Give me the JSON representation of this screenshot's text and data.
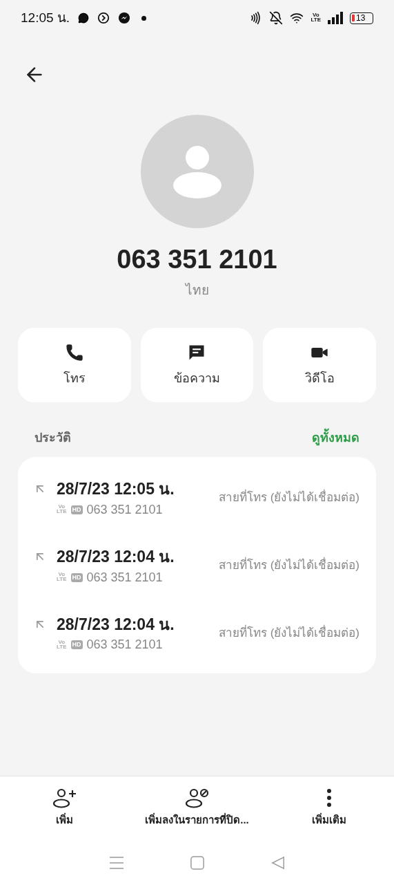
{
  "status_bar": {
    "time": "12:05 น.",
    "volte": [
      "Vo",
      "LTE"
    ],
    "battery": "13"
  },
  "contact": {
    "number": "063 351 2101",
    "location": "ไทย"
  },
  "actions": [
    {
      "kind": "call",
      "label": "โทร"
    },
    {
      "kind": "message",
      "label": "ข้อความ"
    },
    {
      "kind": "video",
      "label": "วิดีโอ"
    }
  ],
  "history": {
    "title": "ประวัติ",
    "see_all": "ดูทั้งหมด",
    "calls": [
      {
        "datetime": "28/7/23 12:05 น.",
        "volte": [
          "Vo",
          "LTE"
        ],
        "hd": "HD",
        "number": "063 351 2101",
        "status": "สายที่โทร (ยังไม่ได้เชื่อมต่อ)"
      },
      {
        "datetime": "28/7/23 12:04 น.",
        "volte": [
          "Vo",
          "LTE"
        ],
        "hd": "HD",
        "number": "063 351 2101",
        "status": "สายที่โทร (ยังไม่ได้เชื่อมต่อ)"
      },
      {
        "datetime": "28/7/23 12:04 น.",
        "volte": [
          "Vo",
          "LTE"
        ],
        "hd": "HD",
        "number": "063 351 2101",
        "status": "สายที่โทร (ยังไม่ได้เชื่อมต่อ)"
      }
    ]
  },
  "bottom_actions": [
    {
      "kind": "add",
      "label": "เพิ่ม"
    },
    {
      "kind": "block",
      "label": "เพิ่มลงในรายการที่ปิด..."
    },
    {
      "kind": "more",
      "label": "เพิ่มเติม"
    }
  ]
}
